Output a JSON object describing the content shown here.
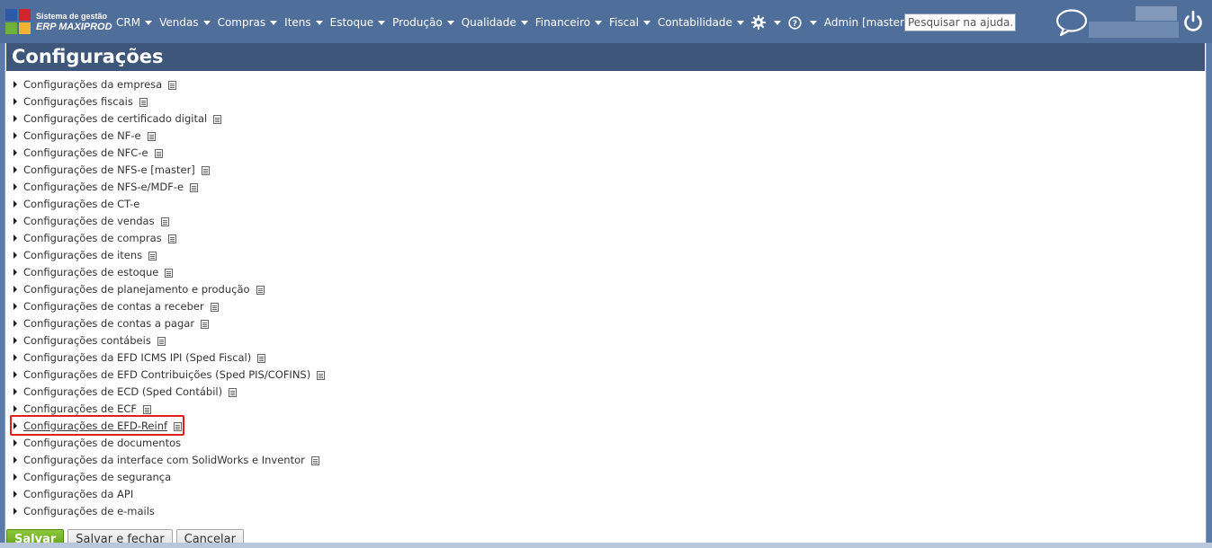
{
  "app": {
    "logo_line1": "Sistema de gestão",
    "logo_line2": "ERP MAXIPROD",
    "brand_colors": [
      "#2d5aa8",
      "#d4242b",
      "#6fb23a",
      "#f2b233"
    ]
  },
  "nav": {
    "items": [
      {
        "label": "CRM"
      },
      {
        "label": "Vendas"
      },
      {
        "label": "Compras"
      },
      {
        "label": "Itens"
      },
      {
        "label": "Estoque"
      },
      {
        "label": "Produção"
      },
      {
        "label": "Qualidade"
      },
      {
        "label": "Financeiro"
      },
      {
        "label": "Fiscal"
      },
      {
        "label": "Contabilidade"
      }
    ],
    "settings_icon": "gear-icon",
    "help_icon": "question-icon",
    "user_label": "Admin [master]",
    "search_placeholder": "Pesquisar na ajuda...",
    "chat_icon": "chat-bubble-icon",
    "logout_icon": "power-icon"
  },
  "page": {
    "title": "Configurações",
    "sections": [
      {
        "label": "Configurações da empresa",
        "doc_icon": true
      },
      {
        "label": "Configurações fiscais",
        "doc_icon": true
      },
      {
        "label": "Configurações de certificado digital",
        "doc_icon": true
      },
      {
        "label": "Configurações de NF-e",
        "doc_icon": true
      },
      {
        "label": "Configurações de NFC-e",
        "doc_icon": true
      },
      {
        "label": "Configurações de NFS-e [master]",
        "doc_icon": true
      },
      {
        "label": "Configurações de NFS-e/MDF-e",
        "doc_icon": true
      },
      {
        "label": "Configurações de CT-e",
        "doc_icon": false
      },
      {
        "label": "Configurações de vendas",
        "doc_icon": true
      },
      {
        "label": "Configurações de compras",
        "doc_icon": true
      },
      {
        "label": "Configurações de itens",
        "doc_icon": true
      },
      {
        "label": "Configurações de estoque",
        "doc_icon": true
      },
      {
        "label": "Configurações de planejamento e produção",
        "doc_icon": true
      },
      {
        "label": "Configurações de contas a receber",
        "doc_icon": true
      },
      {
        "label": "Configurações de contas a pagar",
        "doc_icon": true
      },
      {
        "label": "Configurações contábeis",
        "doc_icon": true
      },
      {
        "label": "Configurações da EFD ICMS IPI (Sped Fiscal)",
        "doc_icon": true
      },
      {
        "label": "Configurações de EFD Contribuições (Sped PIS/COFINS)",
        "doc_icon": true
      },
      {
        "label": "Configurações de ECD (Sped Contábil)",
        "doc_icon": true
      },
      {
        "label": "Configurações de ECF",
        "doc_icon": true
      },
      {
        "label": "Configurações de EFD-Reinf",
        "doc_icon": true,
        "highlighted": true
      },
      {
        "label": "Configurações de documentos",
        "doc_icon": false
      },
      {
        "label": "Configurações da interface com SolidWorks e Inventor",
        "doc_icon": true
      },
      {
        "label": "Configurações de segurança",
        "doc_icon": false
      },
      {
        "label": "Configurações da API",
        "doc_icon": false
      },
      {
        "label": "Configurações de e-mails",
        "doc_icon": false
      }
    ],
    "highlight_color": "#e0201a"
  },
  "actions": {
    "save": "Salvar",
    "save_close": "Salvar e fechar",
    "cancel": "Cancelar"
  }
}
